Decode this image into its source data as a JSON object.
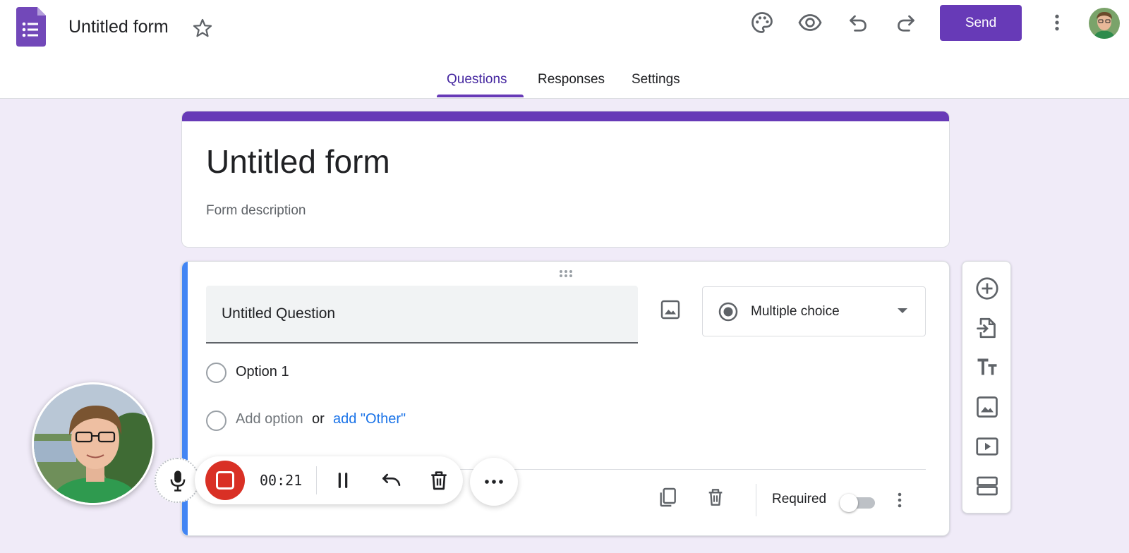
{
  "app": {
    "title": "Untitled form",
    "icons": {
      "doc": "google-forms-icon",
      "star": "star-icon",
      "palette": "palette-icon",
      "preview": "eye-icon",
      "undo": "undo-icon",
      "redo": "redo-icon",
      "more": "more-vert-icon"
    },
    "send_label": "Send",
    "accent_color": "#673ab7"
  },
  "tabs": [
    {
      "label": "Questions",
      "active": true
    },
    {
      "label": "Responses",
      "active": false
    },
    {
      "label": "Settings",
      "active": false
    }
  ],
  "form": {
    "title": "Untitled form",
    "description_placeholder": "Form description"
  },
  "question": {
    "title": "Untitled Question",
    "type": "Multiple choice",
    "options": [
      "Option 1"
    ],
    "add_option": "Add option",
    "or": "or",
    "add_other": "add \"Other\"",
    "required_label": "Required",
    "required": false
  },
  "side_toolbar": [
    "add-question-icon",
    "import-questions-icon",
    "title-text-icon",
    "add-image-icon",
    "add-video-icon",
    "add-section-icon"
  ],
  "recorder": {
    "timer": "00:21",
    "stop_color": "#d93025"
  }
}
